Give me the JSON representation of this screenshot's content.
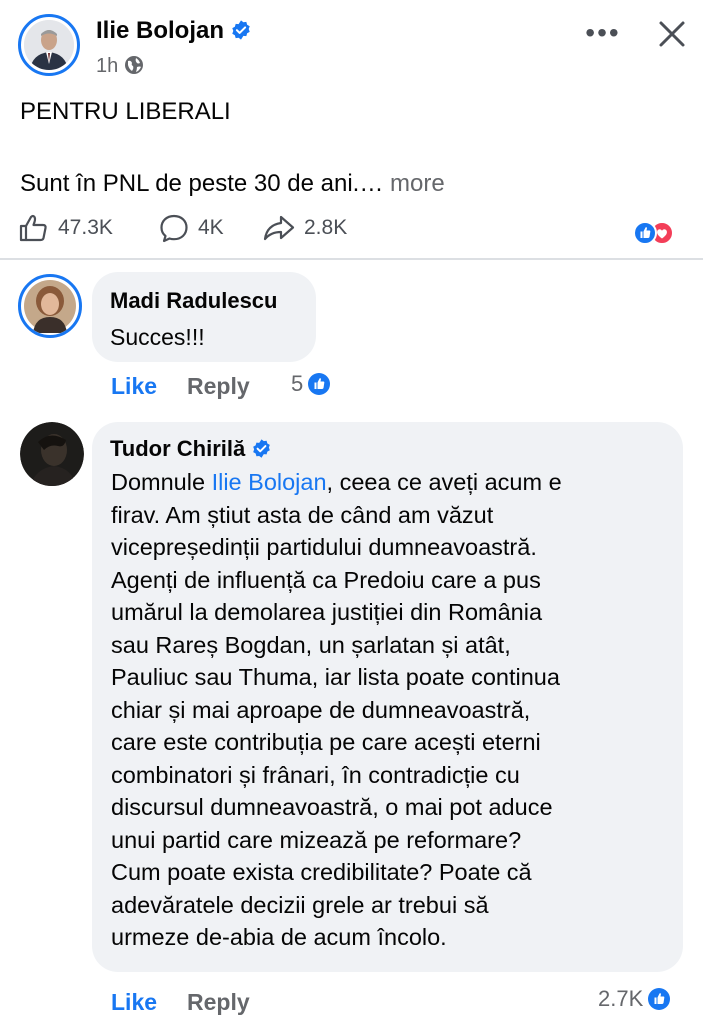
{
  "post": {
    "author": "Ilie Bolojan",
    "time": "1h",
    "title": "PENTRU LIBERALI",
    "text": "Sunt în PNL de peste 30 de ani.…",
    "more_label": "more",
    "more_menu": "•••"
  },
  "stats": {
    "likes": "47.3K",
    "comments": "4K",
    "shares": "2.8K"
  },
  "comments": [
    {
      "author": "Madi Radulescu",
      "text": "Succes!!!",
      "like_label": "Like",
      "reply_label": "Reply",
      "reaction_count": "5"
    },
    {
      "author": "Tudor Chirilă",
      "text_prefix": "Domnule ",
      "mention": "Ilie Bolojan",
      "lines": [
        ", ceea ce aveți acum e",
        "firav. Am știut asta de când am văzut",
        "vicepreședinții partidului dumneavoastră.",
        "Agenți de influență ca Predoiu care a pus",
        "umărul la demolarea justiției din România",
        "sau Rareș Bogdan, un șarlatan și atât,",
        "Pauliuc sau Thuma, iar lista poate continua",
        "chiar și mai aproape de dumneavoastră,",
        "care este contribuția pe care acești eterni",
        "combinatori și frânari, în contradicție cu",
        "discursul dumneavoastră, o mai pot aduce",
        "unui partid care mizează pe reformare?",
        "Cum poate exista credibilitate? Poate că",
        "adevăratele decizii grele ar trebui să",
        "urmeze de-abia de acum încolo."
      ],
      "like_label": "Like",
      "reply_label": "Reply",
      "reaction_count": "2.7K"
    }
  ],
  "colors": {
    "accent": "#1877f2",
    "love": "#f33e58",
    "bubble": "#f0f2f5",
    "secondary_text": "#65676b"
  },
  "icons": {
    "verified": "verified-badge-icon",
    "globe": "globe-icon",
    "like": "thumbs-up-icon",
    "comment": "comment-bubble-icon",
    "share": "share-arrow-icon",
    "close": "close-icon"
  }
}
